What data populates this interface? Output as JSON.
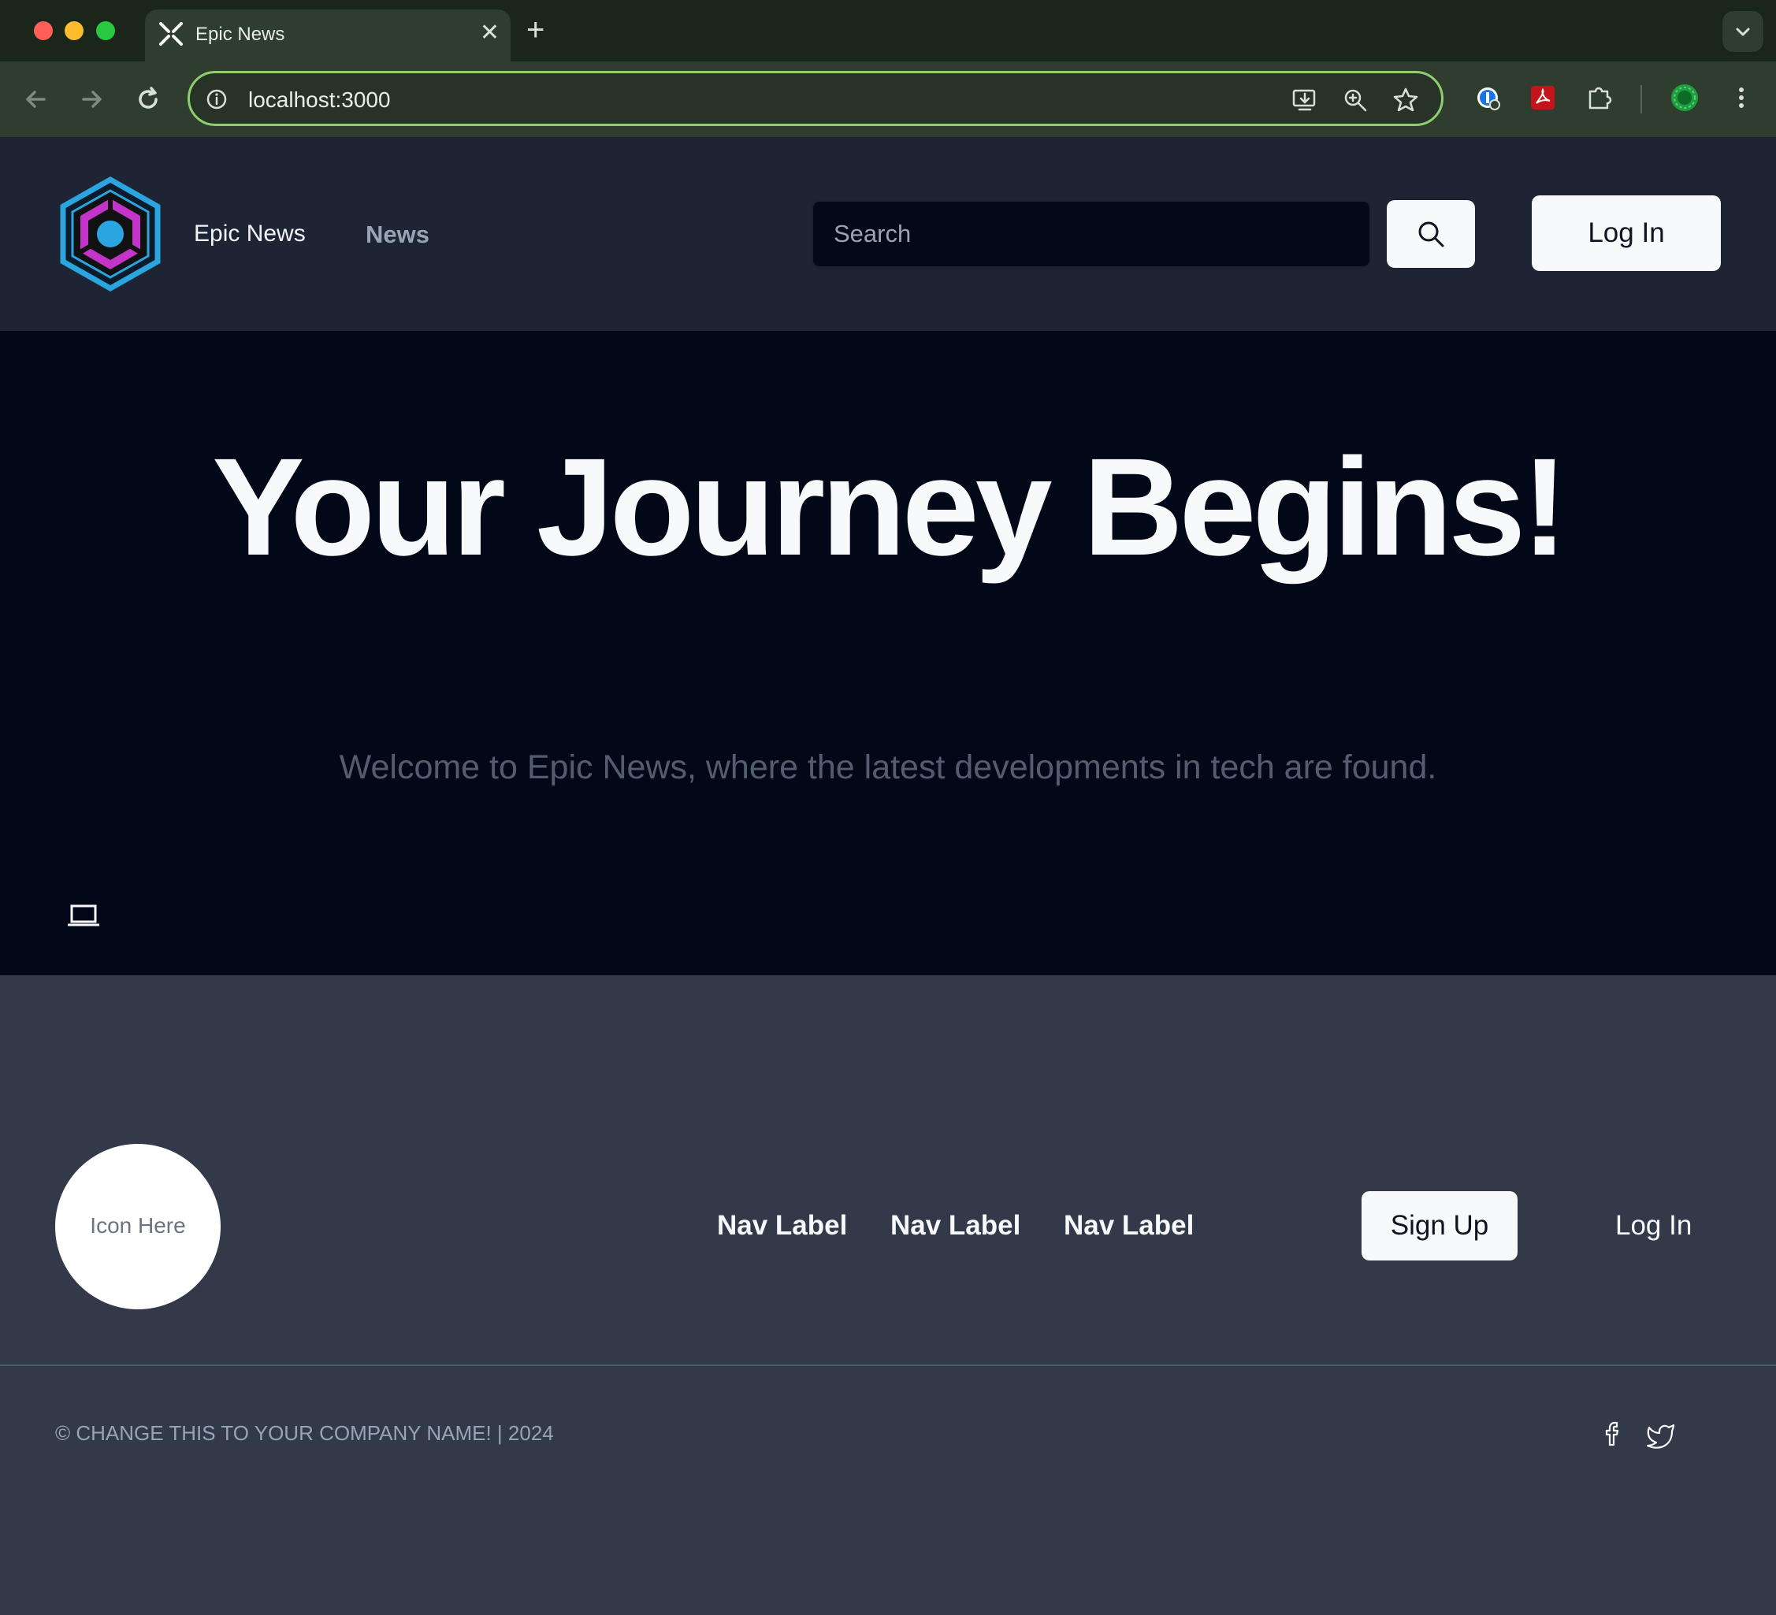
{
  "browser": {
    "tab_title": "Epic News",
    "tab_close": "✕",
    "new_tab": "+",
    "url": "localhost:3000"
  },
  "header": {
    "brand": "Epic News",
    "nav_news": "News",
    "search_placeholder": "Search",
    "login_label": "Log In"
  },
  "hero": {
    "title": "Your Journey Begins!",
    "subtitle": "Welcome to Epic News, where the latest developments in tech are found."
  },
  "footer": {
    "icon_placeholder": "Icon Here",
    "nav_labels": [
      "Nav Label",
      "Nav Label",
      "Nav Label"
    ],
    "signup_label": "Sign Up",
    "login_label": "Log In",
    "copyright": "© CHANGE THIS TO YOUR COMPANY NAME! | 2024"
  },
  "icons": {
    "logo": "hexagon-logo-icon",
    "search": "search-icon",
    "laptop": "laptop-icon",
    "facebook": "facebook-icon",
    "twitter": "twitter-icon"
  },
  "colors": {
    "header_bg": "#1d2433",
    "hero_bg": "#020817",
    "footer_bg": "#323a4a",
    "accent_green": "#8fce6f",
    "logo_blue": "#2aa5e0",
    "logo_magenta": "#c334c9"
  }
}
